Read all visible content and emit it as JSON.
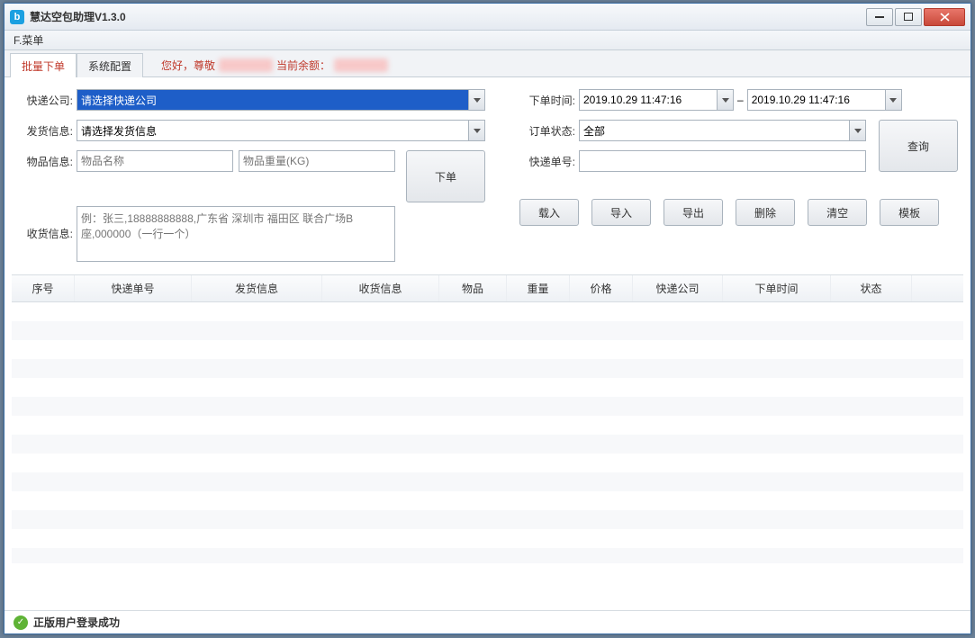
{
  "window": {
    "title": "慧达空包助理V1.3.0"
  },
  "menubar": {
    "file": "F.菜单"
  },
  "tabs": {
    "batch": "批量下单",
    "config": "系统配置"
  },
  "greeting": {
    "hello": "您好，尊敬",
    "balance_label": "当前余额："
  },
  "left": {
    "courier_label": "快递公司:",
    "courier_value": "请选择快递公司",
    "shipinfo_label": "发货信息:",
    "shipinfo_value": "请选择发货信息",
    "goods_label": "物品信息:",
    "goods_name_ph": "物品名称",
    "goods_weight_ph": "物品重量(KG)",
    "recv_label": "收货信息:",
    "recv_ph": "例：张三,18888888888,广东省 深圳市 福田区 联合广场B座,000000（一行一个）",
    "order_btn": "下单"
  },
  "right": {
    "time_label": "下单时间:",
    "time_from": "2019.10.29 11:47:16",
    "dash": "–",
    "time_to": "2019.10.29 11:47:16",
    "status_label": "订单状态:",
    "status_value": "全部",
    "trackno_label": "快递单号:",
    "trackno_value": "",
    "query_btn": "查询",
    "btns": {
      "load": "载入",
      "import": "导入",
      "export": "导出",
      "delete": "删除",
      "clear": "清空",
      "template": "模板"
    }
  },
  "table": {
    "headers": [
      "序号",
      "快递单号",
      "发货信息",
      "收货信息",
      "物品",
      "重量",
      "价格",
      "快递公司",
      "下单时间",
      "状态"
    ],
    "widths": [
      70,
      130,
      145,
      130,
      75,
      70,
      70,
      100,
      120,
      90
    ]
  },
  "status": {
    "text": "正版用户登录成功"
  }
}
